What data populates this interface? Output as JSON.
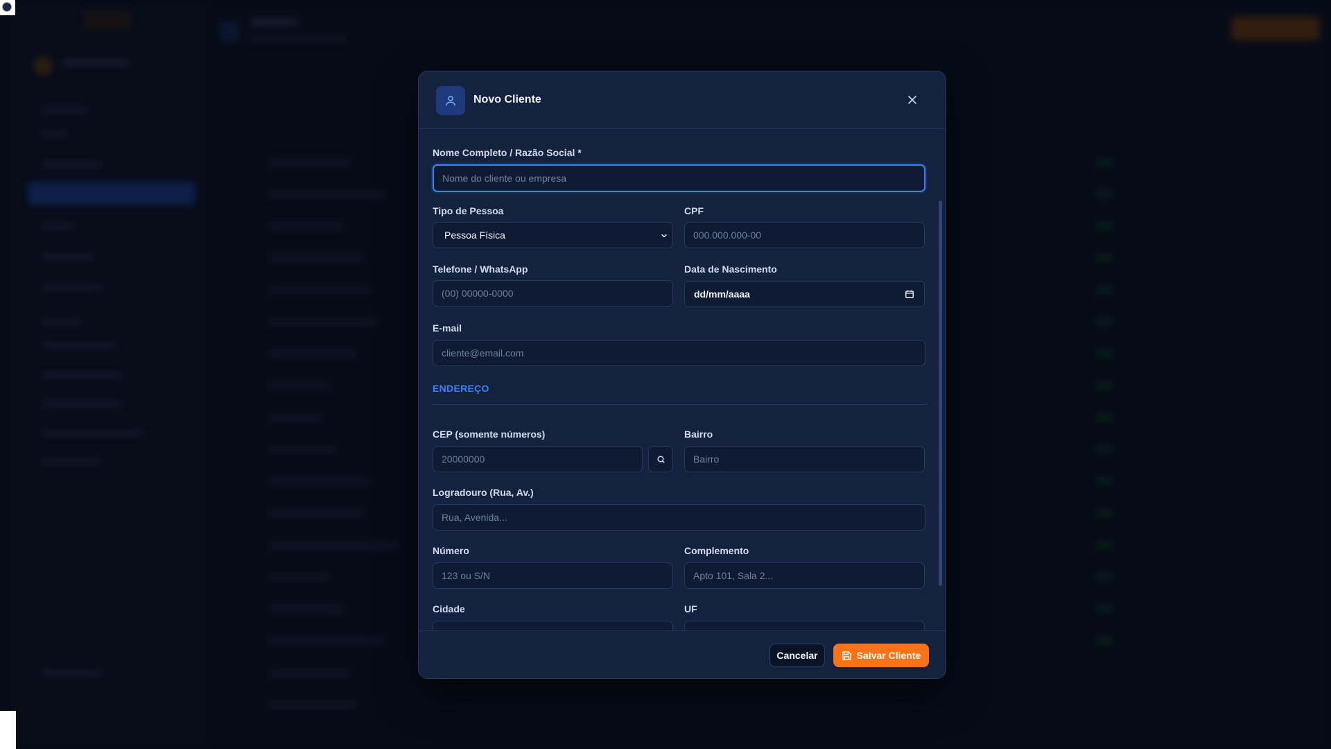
{
  "modal": {
    "title": "Novo Cliente",
    "header_icon": "user-icon",
    "close_icon": "close-icon"
  },
  "form": {
    "nome": {
      "label": "Nome Completo / Razão Social *",
      "placeholder": "Nome do cliente ou empresa",
      "value": ""
    },
    "tipo_pessoa": {
      "label": "Tipo de Pessoa",
      "selected": "Pessoa Física"
    },
    "cpf": {
      "label": "CPF",
      "placeholder": "000.000.000-00"
    },
    "telefone": {
      "label": "Telefone / WhatsApp",
      "placeholder": "(00) 00000-0000"
    },
    "nascimento": {
      "label": "Data de Nascimento",
      "value": "dd/mm/aaaa"
    },
    "email": {
      "label": "E-mail",
      "placeholder": "cliente@email.com"
    },
    "endereco_section": "ENDEREÇO",
    "cep": {
      "label": "CEP (somente números)",
      "placeholder": "20000000"
    },
    "bairro": {
      "label": "Bairro",
      "placeholder": "Bairro"
    },
    "logradouro": {
      "label": "Logradouro (Rua, Av.)",
      "placeholder": "Rua, Avenida..."
    },
    "numero": {
      "label": "Número",
      "placeholder": "123 ou S/N"
    },
    "complemento": {
      "label": "Complemento",
      "placeholder": "Apto 101, Sala 2..."
    },
    "cidade": {
      "label": "Cidade"
    },
    "uf": {
      "label": "UF"
    }
  },
  "footer": {
    "cancel_label": "Cancelar",
    "save_label": "Salvar Cliente"
  },
  "colors": {
    "accent": "#3b82f6",
    "primary_button": "#f97316",
    "modal_bg": "#14223f",
    "input_bg": "#0f1b33"
  }
}
